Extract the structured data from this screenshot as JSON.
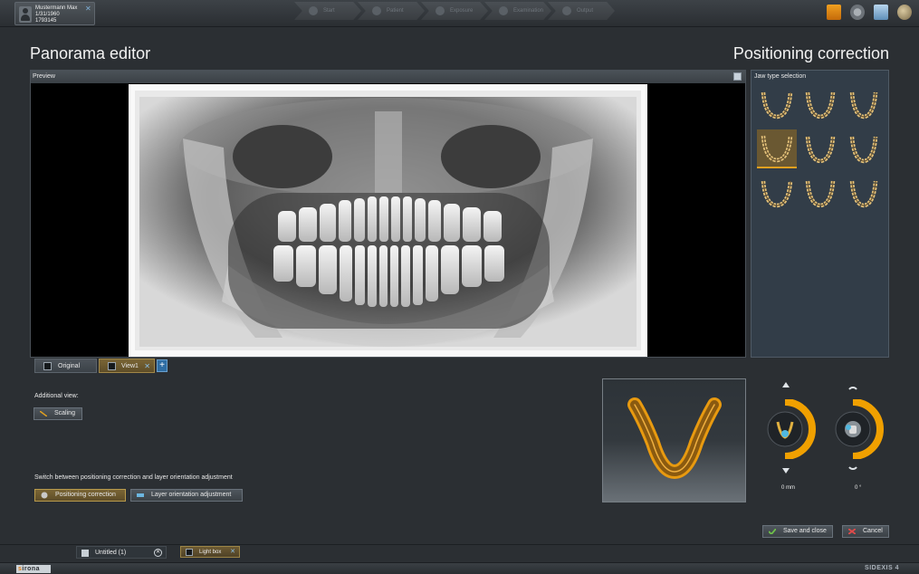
{
  "patient": {
    "name": "Mustermann Max",
    "dob": "1/31/1960",
    "id": "1793145"
  },
  "workflow": [
    "Start",
    "Patient",
    "Exposure",
    "Examination",
    "Output"
  ],
  "headings": {
    "left": "Panorama editor",
    "right": "Positioning correction"
  },
  "preview": {
    "label": "Preview"
  },
  "jaw_panel": {
    "title": "Jaw type selection",
    "selected_index": 3
  },
  "tabs": {
    "original": "Original",
    "view1": "View1"
  },
  "additional": {
    "label": "Additional view:",
    "scaling": "Scaling"
  },
  "switch": {
    "label": "Switch between positioning correction and layer orientation adjustment",
    "positioning": "Positioning correction",
    "layer": "Layer orientation adjustment"
  },
  "dials": {
    "left_value": "0",
    "left_unit": "mm",
    "right_value": "0",
    "right_unit": "°"
  },
  "actions": {
    "save": "Save and close",
    "cancel": "Cancel"
  },
  "documents": {
    "untitled": "Untitled (1)",
    "lightbox": "Light box"
  },
  "brand": {
    "left": "sirona",
    "right": "SIDEXIS 4"
  },
  "colors": {
    "accent": "#f0a000",
    "background": "#2b2f33",
    "panel": "#323d48"
  }
}
